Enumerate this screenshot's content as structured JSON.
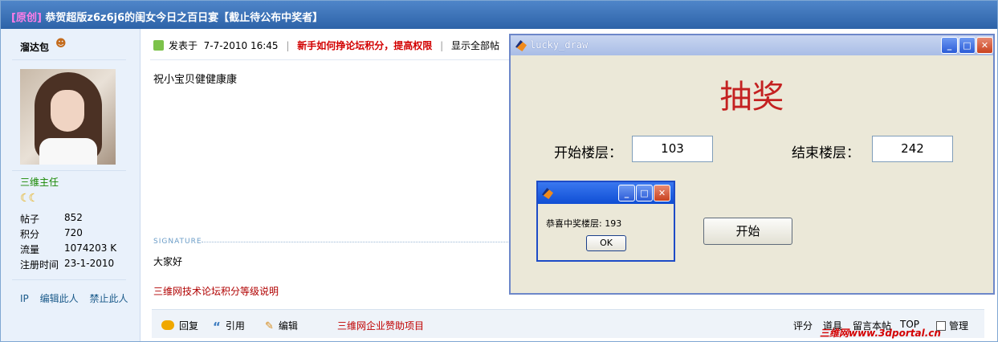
{
  "thread": {
    "tag": "[原创]",
    "title": "恭贺超版z6z6j6的闺女今日之百日宴【截止待公布中奖者】"
  },
  "author": {
    "name": "溜达包",
    "rank": "三维主任",
    "stats": [
      {
        "label": "帖子",
        "value": "852"
      },
      {
        "label": "积分",
        "value": "720"
      },
      {
        "label": "流量",
        "value": "1074203 K"
      },
      {
        "label": "注册时间",
        "value": "23-1-2010"
      }
    ],
    "actions": [
      "IP",
      "编辑此人",
      "禁止此人"
    ]
  },
  "post": {
    "posted_prefix": "发表于",
    "posted_time": "7-7-2010 16:45",
    "promo_link": "新手如何挣论坛积分，提高权限",
    "show_all": "显示全部帖",
    "message": "祝小宝贝健健康康",
    "signature_label": "SIGNATURE",
    "signature": "大家好",
    "rules_link": "三维网技术论坛积分等级说明"
  },
  "actions": {
    "reply": "回复",
    "quote": "引用",
    "edit": "编辑",
    "sponsor": "三维网企业赞助项目",
    "rate": "评分",
    "props": "道具",
    "leave_msg": "留言本帖",
    "top": "TOP",
    "manage": "管理"
  },
  "watermark": "三维网www.3dportal.cn",
  "lucky_draw": {
    "window_title": "lucky_draw",
    "heading": "抽奖",
    "start_floor_label": "开始楼层：",
    "start_floor": "103",
    "end_floor_label": "结束楼层：",
    "end_floor": "242",
    "start_button": "开始"
  },
  "result_dialog": {
    "message": "恭喜中奖楼层: 193",
    "ok": "OK"
  },
  "colors": {
    "title_bar": "#2d63a8",
    "heading_red": "#c42121",
    "promo_red": "#d20000",
    "window_bg": "#ebe8d8",
    "dialog_border": "#1d4bc7"
  },
  "icons": [
    "gender-icon",
    "posted-icon",
    "reply-icon",
    "quote-icon",
    "edit-icon",
    "matlab-icon",
    "minimize-icon",
    "maximize-icon",
    "close-icon"
  ]
}
